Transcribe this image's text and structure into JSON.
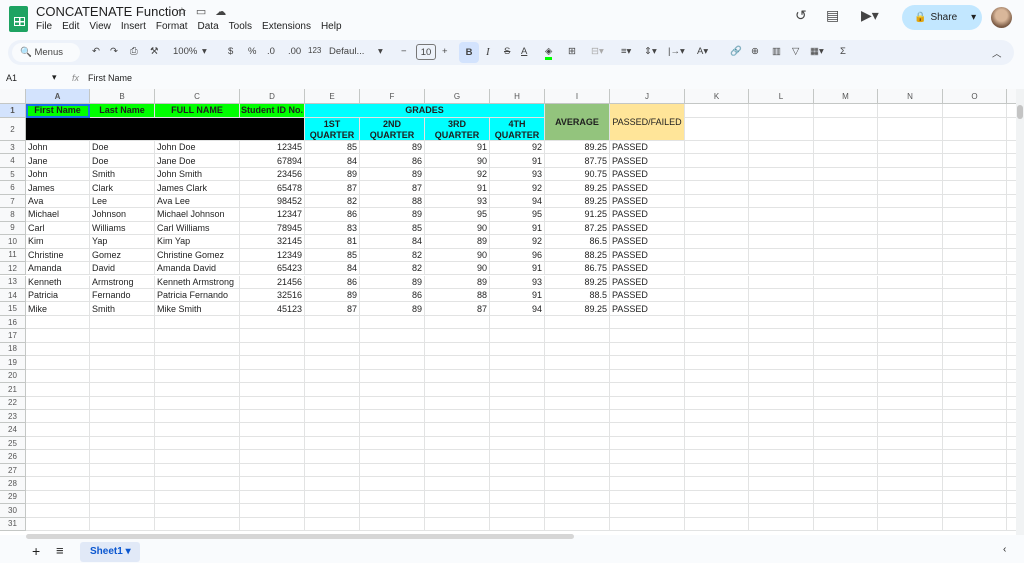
{
  "app": {
    "title": "CONCATENATE Function",
    "menus": [
      "File",
      "Edit",
      "View",
      "Insert",
      "Format",
      "Data",
      "Tools",
      "Extensions",
      "Help"
    ],
    "share_label": "Share"
  },
  "toolbar": {
    "search": "Menus",
    "zoom": "100%",
    "currency": "$",
    "percent": "%",
    "dec_less": ".0",
    "dec_more": ".00",
    "format_num": "123",
    "font": "Defaul...",
    "font_size": "10",
    "bold": "B",
    "italic": "I",
    "sigma": "Σ"
  },
  "formula_bar": {
    "cell_ref": "A1",
    "fx": "fx",
    "content": "First Name"
  },
  "columns": [
    "A",
    "B",
    "C",
    "D",
    "E",
    "F",
    "G",
    "H",
    "I",
    "J",
    "K",
    "L",
    "M",
    "N",
    "O"
  ],
  "headers": {
    "first": "First Name",
    "last": "Last Name",
    "full": "FULL NAME",
    "id": "Student ID No.",
    "grades": "GRADES",
    "q1": "1ST QUARTER",
    "q2": "2ND QUARTER",
    "q3": "3RD QUARTER",
    "q4": "4TH QUARTER",
    "avg": "AVERAGE",
    "pf": "PASSED/FAILED"
  },
  "rows": [
    [
      "John",
      "Doe",
      "John Doe",
      "12345",
      "85",
      "89",
      "91",
      "92",
      "89.25",
      "PASSED"
    ],
    [
      "Jane",
      "Doe",
      "Jane Doe",
      "67894",
      "84",
      "86",
      "90",
      "91",
      "87.75",
      "PASSED"
    ],
    [
      "John",
      "Smith",
      "John Smith",
      "23456",
      "89",
      "89",
      "92",
      "93",
      "90.75",
      "PASSED"
    ],
    [
      "James",
      "Clark",
      "James Clark",
      "65478",
      "87",
      "87",
      "91",
      "92",
      "89.25",
      "PASSED"
    ],
    [
      "Ava",
      "Lee",
      "Ava Lee",
      "98452",
      "82",
      "88",
      "93",
      "94",
      "89.25",
      "PASSED"
    ],
    [
      "Michael",
      "Johnson",
      "Michael  Johnson",
      "12347",
      "86",
      "89",
      "95",
      "95",
      "91.25",
      "PASSED"
    ],
    [
      "Carl",
      "Williams",
      "Carl Williams",
      "78945",
      "83",
      "85",
      "90",
      "91",
      "87.25",
      "PASSED"
    ],
    [
      "Kim",
      "Yap",
      "Kim Yap",
      "32145",
      "81",
      "84",
      "89",
      "92",
      "86.5",
      "PASSED"
    ],
    [
      "Christine",
      "Gomez",
      "Christine Gomez",
      "12349",
      "85",
      "82",
      "90",
      "96",
      "88.25",
      "PASSED"
    ],
    [
      "Amanda",
      "David",
      "Amanda David",
      "65423",
      "84",
      "82",
      "90",
      "91",
      "86.75",
      "PASSED"
    ],
    [
      "Kenneth",
      "Armstrong",
      "Kenneth Armstrong",
      "21456",
      "86",
      "89",
      "89",
      "93",
      "89.25",
      "PASSED"
    ],
    [
      "Patricia",
      "Fernando",
      "Patricia Fernando",
      "32516",
      "89",
      "86",
      "88",
      "91",
      "88.5",
      "PASSED"
    ],
    [
      "Mike",
      "Smith",
      "Mike Smith",
      "45123",
      "87",
      "89",
      "87",
      "94",
      "89.25",
      "PASSED"
    ]
  ],
  "total_rows": 31,
  "sheet_tab": "Sheet1",
  "colors": {
    "green": "#00ff00",
    "cyan": "#00ffff",
    "avg": "#93c47d",
    "pf": "#ffe599",
    "black": "#000000"
  }
}
